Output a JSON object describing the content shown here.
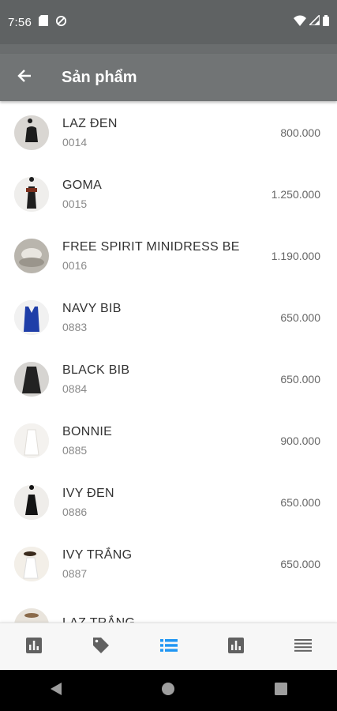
{
  "status_bar": {
    "time": "7:56",
    "left_icons": [
      "sd-card-icon",
      "sync-icon"
    ],
    "right_icons": [
      "wifi-icon",
      "signal-icon",
      "battery-icon"
    ]
  },
  "app_bar": {
    "title": "Sản phẩm",
    "background": "#717475",
    "back_icon": "arrow-left-icon"
  },
  "products": [
    {
      "name": "LAZ ĐEN",
      "code": "0014",
      "price": "800.000"
    },
    {
      "name": "GOMA",
      "code": "0015",
      "price": "1.250.000"
    },
    {
      "name": "FREE SPIRIT MINIDRESS BE",
      "code": "0016",
      "price": "1.190.000"
    },
    {
      "name": "NAVY BIB",
      "code": "0883",
      "price": "650.000"
    },
    {
      "name": "BLACK BIB",
      "code": "0884",
      "price": "650.000"
    },
    {
      "name": "BONNIE",
      "code": "0885",
      "price": "900.000"
    },
    {
      "name": "IVY ĐEN",
      "code": "0886",
      "price": "650.000"
    },
    {
      "name": "IVY TRẮNG",
      "code": "0887",
      "price": "650.000"
    },
    {
      "name": "LAZ TRẮNG",
      "code": "",
      "price": ""
    }
  ],
  "bottom_nav": {
    "items": [
      {
        "icon": "bar-chart-icon",
        "active": false
      },
      {
        "icon": "tag-icon",
        "active": false
      },
      {
        "icon": "list-icon",
        "active": true
      },
      {
        "icon": "report-icon",
        "active": false
      },
      {
        "icon": "menu-icon",
        "active": false
      }
    ],
    "active_color": "#2196f3",
    "inactive_color": "#616161"
  },
  "system_nav": [
    "back-triangle-icon",
    "home-circle-icon",
    "recents-square-icon"
  ]
}
